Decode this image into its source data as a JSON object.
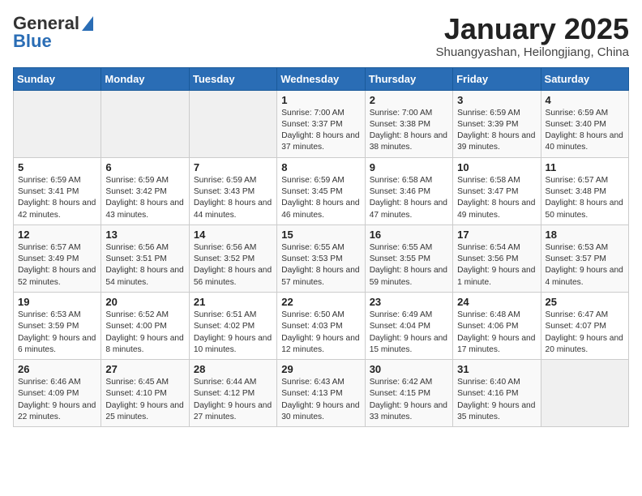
{
  "header": {
    "logo_general": "General",
    "logo_blue": "Blue",
    "title": "January 2025",
    "subtitle": "Shuangyashan, Heilongjiang, China"
  },
  "days_of_week": [
    "Sunday",
    "Monday",
    "Tuesday",
    "Wednesday",
    "Thursday",
    "Friday",
    "Saturday"
  ],
  "weeks": [
    [
      {
        "day": "",
        "info": ""
      },
      {
        "day": "",
        "info": ""
      },
      {
        "day": "",
        "info": ""
      },
      {
        "day": "1",
        "info": "Sunrise: 7:00 AM\nSunset: 3:37 PM\nDaylight: 8 hours and 37 minutes."
      },
      {
        "day": "2",
        "info": "Sunrise: 7:00 AM\nSunset: 3:38 PM\nDaylight: 8 hours and 38 minutes."
      },
      {
        "day": "3",
        "info": "Sunrise: 6:59 AM\nSunset: 3:39 PM\nDaylight: 8 hours and 39 minutes."
      },
      {
        "day": "4",
        "info": "Sunrise: 6:59 AM\nSunset: 3:40 PM\nDaylight: 8 hours and 40 minutes."
      }
    ],
    [
      {
        "day": "5",
        "info": "Sunrise: 6:59 AM\nSunset: 3:41 PM\nDaylight: 8 hours and 42 minutes."
      },
      {
        "day": "6",
        "info": "Sunrise: 6:59 AM\nSunset: 3:42 PM\nDaylight: 8 hours and 43 minutes."
      },
      {
        "day": "7",
        "info": "Sunrise: 6:59 AM\nSunset: 3:43 PM\nDaylight: 8 hours and 44 minutes."
      },
      {
        "day": "8",
        "info": "Sunrise: 6:59 AM\nSunset: 3:45 PM\nDaylight: 8 hours and 46 minutes."
      },
      {
        "day": "9",
        "info": "Sunrise: 6:58 AM\nSunset: 3:46 PM\nDaylight: 8 hours and 47 minutes."
      },
      {
        "day": "10",
        "info": "Sunrise: 6:58 AM\nSunset: 3:47 PM\nDaylight: 8 hours and 49 minutes."
      },
      {
        "day": "11",
        "info": "Sunrise: 6:57 AM\nSunset: 3:48 PM\nDaylight: 8 hours and 50 minutes."
      }
    ],
    [
      {
        "day": "12",
        "info": "Sunrise: 6:57 AM\nSunset: 3:49 PM\nDaylight: 8 hours and 52 minutes."
      },
      {
        "day": "13",
        "info": "Sunrise: 6:56 AM\nSunset: 3:51 PM\nDaylight: 8 hours and 54 minutes."
      },
      {
        "day": "14",
        "info": "Sunrise: 6:56 AM\nSunset: 3:52 PM\nDaylight: 8 hours and 56 minutes."
      },
      {
        "day": "15",
        "info": "Sunrise: 6:55 AM\nSunset: 3:53 PM\nDaylight: 8 hours and 57 minutes."
      },
      {
        "day": "16",
        "info": "Sunrise: 6:55 AM\nSunset: 3:55 PM\nDaylight: 8 hours and 59 minutes."
      },
      {
        "day": "17",
        "info": "Sunrise: 6:54 AM\nSunset: 3:56 PM\nDaylight: 9 hours and 1 minute."
      },
      {
        "day": "18",
        "info": "Sunrise: 6:53 AM\nSunset: 3:57 PM\nDaylight: 9 hours and 4 minutes."
      }
    ],
    [
      {
        "day": "19",
        "info": "Sunrise: 6:53 AM\nSunset: 3:59 PM\nDaylight: 9 hours and 6 minutes."
      },
      {
        "day": "20",
        "info": "Sunrise: 6:52 AM\nSunset: 4:00 PM\nDaylight: 9 hours and 8 minutes."
      },
      {
        "day": "21",
        "info": "Sunrise: 6:51 AM\nSunset: 4:02 PM\nDaylight: 9 hours and 10 minutes."
      },
      {
        "day": "22",
        "info": "Sunrise: 6:50 AM\nSunset: 4:03 PM\nDaylight: 9 hours and 12 minutes."
      },
      {
        "day": "23",
        "info": "Sunrise: 6:49 AM\nSunset: 4:04 PM\nDaylight: 9 hours and 15 minutes."
      },
      {
        "day": "24",
        "info": "Sunrise: 6:48 AM\nSunset: 4:06 PM\nDaylight: 9 hours and 17 minutes."
      },
      {
        "day": "25",
        "info": "Sunrise: 6:47 AM\nSunset: 4:07 PM\nDaylight: 9 hours and 20 minutes."
      }
    ],
    [
      {
        "day": "26",
        "info": "Sunrise: 6:46 AM\nSunset: 4:09 PM\nDaylight: 9 hours and 22 minutes."
      },
      {
        "day": "27",
        "info": "Sunrise: 6:45 AM\nSunset: 4:10 PM\nDaylight: 9 hours and 25 minutes."
      },
      {
        "day": "28",
        "info": "Sunrise: 6:44 AM\nSunset: 4:12 PM\nDaylight: 9 hours and 27 minutes."
      },
      {
        "day": "29",
        "info": "Sunrise: 6:43 AM\nSunset: 4:13 PM\nDaylight: 9 hours and 30 minutes."
      },
      {
        "day": "30",
        "info": "Sunrise: 6:42 AM\nSunset: 4:15 PM\nDaylight: 9 hours and 33 minutes."
      },
      {
        "day": "31",
        "info": "Sunrise: 6:40 AM\nSunset: 4:16 PM\nDaylight: 9 hours and 35 minutes."
      },
      {
        "day": "",
        "info": ""
      }
    ]
  ]
}
